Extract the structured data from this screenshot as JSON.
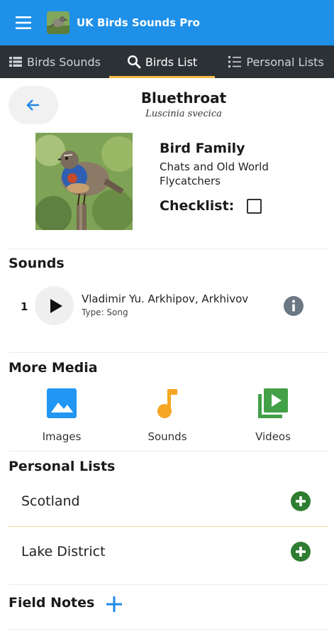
{
  "app": {
    "title": "UK Birds Sounds Pro"
  },
  "tabs": [
    {
      "label": "Birds Sounds",
      "icon": "list-icon",
      "active": false
    },
    {
      "label": "Birds List",
      "icon": "search-icon",
      "active": true
    },
    {
      "label": "Personal Lists",
      "icon": "checklist-icon",
      "active": false
    }
  ],
  "bird": {
    "name": "Bluethroat",
    "latin": "Luscinia svecica",
    "family_label": "Bird Family",
    "family_value": "Chats and Old World Flycatchers",
    "checklist_label": "Checklist:",
    "checklist_checked": false
  },
  "sounds": {
    "title": "Sounds",
    "items": [
      {
        "index": "1",
        "author": "Vladimir Yu. Arkhipov, Arkhivov",
        "type": "Type: Song"
      }
    ]
  },
  "more_media": {
    "title": "More Media",
    "items": [
      {
        "label": "Images",
        "icon": "image-icon",
        "color": "#2196f3"
      },
      {
        "label": "Sounds",
        "icon": "music-note-icon",
        "color": "#f5a623"
      },
      {
        "label": "Videos",
        "icon": "video-library-icon",
        "color": "#43a047"
      }
    ]
  },
  "personal_lists": {
    "title": "Personal Lists",
    "items": [
      {
        "name": "Scotland"
      },
      {
        "name": "Lake District"
      }
    ]
  },
  "field_notes": {
    "title": "Field Notes"
  },
  "colors": {
    "appbar": "#1e90e8",
    "tabbar": "#2c3136",
    "tab_indicator": "#f5b942",
    "add_green": "#2e7d32",
    "accent_blue": "#1e88e5"
  }
}
